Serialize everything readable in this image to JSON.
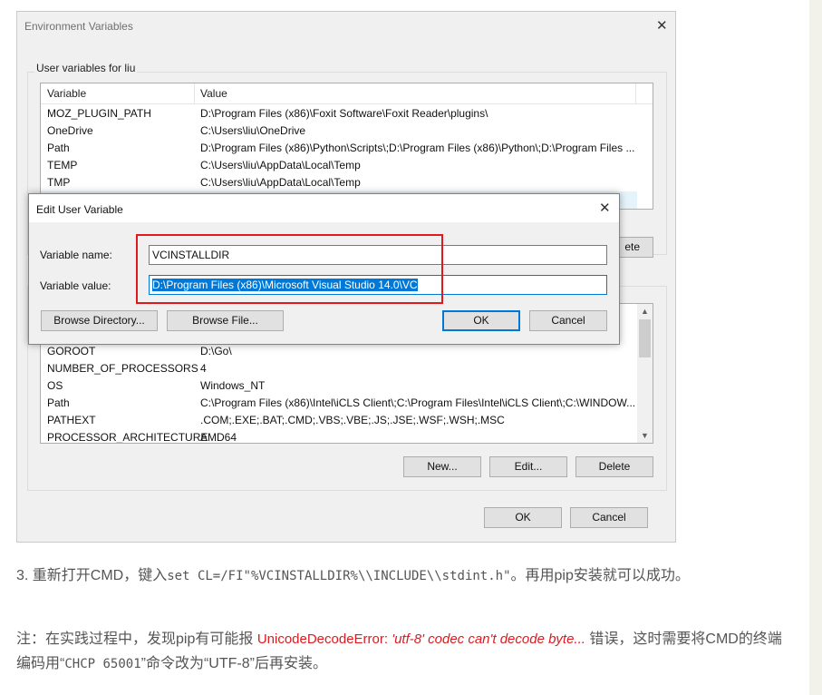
{
  "env_window": {
    "title": "Environment Variables",
    "close_glyph": "✕",
    "user_group_title": "User variables for liu",
    "user_columns": [
      "Variable",
      "Value"
    ],
    "user_rows": [
      {
        "name": "MOZ_PLUGIN_PATH",
        "value": "D:\\Program Files (x86)\\Foxit Software\\Foxit Reader\\plugins\\"
      },
      {
        "name": "OneDrive",
        "value": "C:\\Users\\liu\\OneDrive"
      },
      {
        "name": "Path",
        "value": "D:\\Program Files (x86)\\Python\\Scripts\\;D:\\Program Files (x86)\\Python\\;D:\\Program Files ..."
      },
      {
        "name": "TEMP",
        "value": "C:\\Users\\liu\\AppData\\Local\\Temp"
      },
      {
        "name": "TMP",
        "value": "C:\\Users\\liu\\AppData\\Local\\Temp"
      }
    ],
    "user_partial_button": "ete",
    "system_rows": [
      {
        "name": "GOROOT",
        "value": "D:\\Go\\"
      },
      {
        "name": "NUMBER_OF_PROCESSORS",
        "value": "4"
      },
      {
        "name": "OS",
        "value": "Windows_NT"
      },
      {
        "name": "Path",
        "value": "C:\\Program Files (x86)\\Intel\\iCLS Client\\;C:\\Program Files\\Intel\\iCLS Client\\;C:\\WINDOW..."
      },
      {
        "name": "PATHEXT",
        "value": ".COM;.EXE;.BAT;.CMD;.VBS;.VBE;.JS;.JSE;.WSF;.WSH;.MSC"
      },
      {
        "name": "PROCESSOR_ARCHITECTURE",
        "value": "AMD64"
      }
    ],
    "system_buttons": {
      "new": "New...",
      "edit": "Edit...",
      "delete": "Delete"
    },
    "ok": "OK",
    "cancel": "Cancel"
  },
  "edit_dialog": {
    "title": "Edit User Variable",
    "close_glyph": "✕",
    "name_label": "Variable name:",
    "name_value": "VCINSTALLDIR",
    "value_label": "Variable value:",
    "value_value": "D:\\Program Files (x86)\\Microsoft Visual Studio 14.0\\VC",
    "browse_directory": "Browse Directory...",
    "browse_file": "Browse File...",
    "ok": "OK",
    "cancel": "Cancel"
  },
  "article": {
    "step3_prefix": "3. 重新打开CMD，键入",
    "step3_code": "set CL=/FI\"%VCINSTALLDIR%\\\\INCLUDE\\\\stdint.h\"",
    "step3_suffix": "。再用pip安装就可以成功。",
    "note_prefix": "注：在实践过程中，发现pip有可能报 ",
    "note_error": "UnicodeDecodeError: ",
    "note_error_italic": "'utf-8' codec can't decode byte...",
    "note_mid": " 错误，这时需要将CMD的终端编码用“",
    "note_code": "CHCP 65001",
    "note_suffix": "”命令改为“UTF-8”后再安装。"
  },
  "colors": {
    "highlight_box": "#e0191e",
    "selection": "#0078d7",
    "dialog_border": "#4a90d9"
  }
}
